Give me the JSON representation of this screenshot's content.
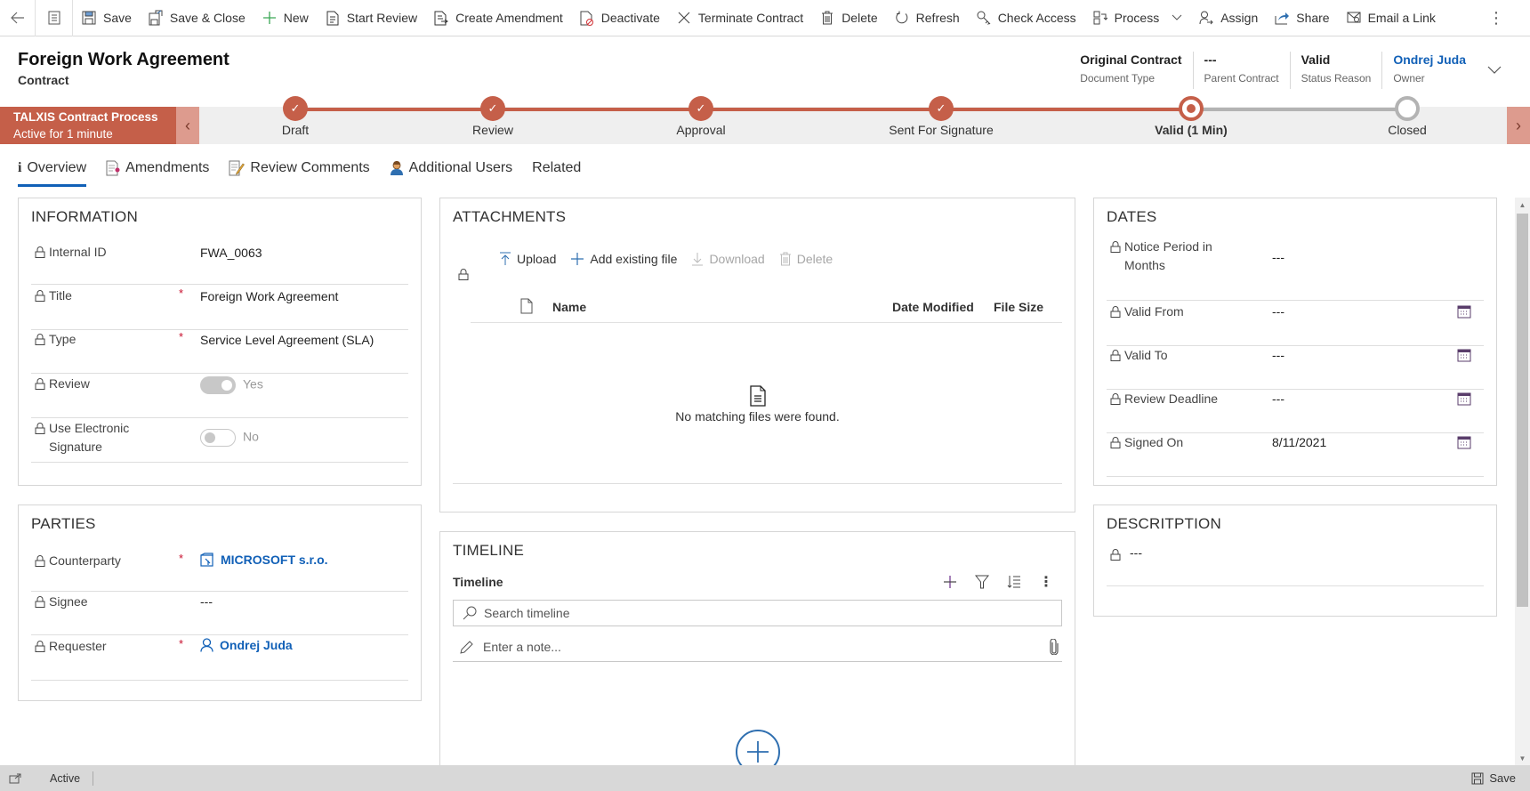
{
  "commandbar": {
    "items": [
      {
        "label": "Save",
        "icon": "save-icon"
      },
      {
        "label": "Save & Close",
        "icon": "save-close-icon"
      },
      {
        "label": "New",
        "icon": "plus-icon"
      },
      {
        "label": "Start Review",
        "icon": "review-document-icon"
      },
      {
        "label": "Create Amendment",
        "icon": "amendment-icon"
      },
      {
        "label": "Deactivate",
        "icon": "deactivate-icon"
      },
      {
        "label": "Terminate Contract",
        "icon": "close-icon"
      },
      {
        "label": "Delete",
        "icon": "trash-icon"
      },
      {
        "label": "Refresh",
        "icon": "refresh-icon"
      },
      {
        "label": "Check Access",
        "icon": "key-icon"
      },
      {
        "label": "Process",
        "icon": "process-icon"
      },
      {
        "label": "Assign",
        "icon": "assign-icon"
      },
      {
        "label": "Share",
        "icon": "share-icon"
      },
      {
        "label": "Email a Link",
        "icon": "email-link-icon"
      }
    ]
  },
  "header": {
    "title": "Foreign Work Agreement",
    "entity": "Contract",
    "fields": [
      {
        "value": "Original Contract",
        "label": "Document Type"
      },
      {
        "value": "---",
        "label": "Parent Contract"
      },
      {
        "value": "Valid",
        "label": "Status Reason"
      },
      {
        "value": "Ondrej Juda",
        "label": "Owner"
      }
    ]
  },
  "process": {
    "name": "TALXIS Contract Process",
    "duration": "Active for 1 minute",
    "stages": [
      {
        "label": "Draft",
        "state": "done"
      },
      {
        "label": "Review",
        "state": "done"
      },
      {
        "label": "Approval",
        "state": "done"
      },
      {
        "label": "Sent For Signature",
        "state": "done"
      },
      {
        "label": "Valid  (1 Min)",
        "state": "active"
      },
      {
        "label": "Closed",
        "state": "future"
      }
    ]
  },
  "tabs": [
    {
      "label": "Overview",
      "selected": true
    },
    {
      "label": "Amendments"
    },
    {
      "label": "Review Comments"
    },
    {
      "label": "Additional Users"
    },
    {
      "label": "Related"
    }
  ],
  "information": {
    "title": "INFORMATION",
    "internal_id": {
      "label": "Internal ID",
      "value": "FWA_0063"
    },
    "title_field": {
      "label": "Title",
      "value": "Foreign Work Agreement"
    },
    "type": {
      "label": "Type",
      "value": "Service Level Agreement (SLA)"
    },
    "review": {
      "label": "Review",
      "value": "Yes"
    },
    "esign": {
      "label": "Use Electronic Signature",
      "value": "No"
    }
  },
  "parties": {
    "title": "PARTIES",
    "counterparty": {
      "label": "Counterparty",
      "value": "MICROSOFT s.r.o."
    },
    "signee": {
      "label": "Signee",
      "value": "---"
    },
    "requester": {
      "label": "Requester",
      "value": "Ondrej Juda"
    }
  },
  "attachments": {
    "title": "ATTACHMENTS",
    "tools": {
      "upload": "Upload",
      "add_existing": "Add existing file",
      "download": "Download",
      "delete": "Delete"
    },
    "columns": {
      "name": "Name",
      "date_modified": "Date Modified",
      "file_size": "File Size"
    },
    "empty_message": "No matching files were found."
  },
  "timeline": {
    "title": "TIMELINE",
    "subtitle": "Timeline",
    "search_placeholder": "Search timeline",
    "note_placeholder": "Enter a note..."
  },
  "dates": {
    "title": "DATES",
    "notice_period": {
      "label": "Notice Period in Months",
      "value": "---"
    },
    "valid_from": {
      "label": "Valid From",
      "value": "---"
    },
    "valid_to": {
      "label": "Valid To",
      "value": "---"
    },
    "review_deadline": {
      "label": "Review Deadline",
      "value": "---"
    },
    "signed_on": {
      "label": "Signed On",
      "value": "8/11/2021"
    }
  },
  "description": {
    "title": "DESCRITPTION",
    "value": "---"
  },
  "statusbar": {
    "status": "Active",
    "save_label": "Save"
  },
  "colors": {
    "process_accent": "#c55f49",
    "link": "#1160b7",
    "required": "#c8102e"
  }
}
